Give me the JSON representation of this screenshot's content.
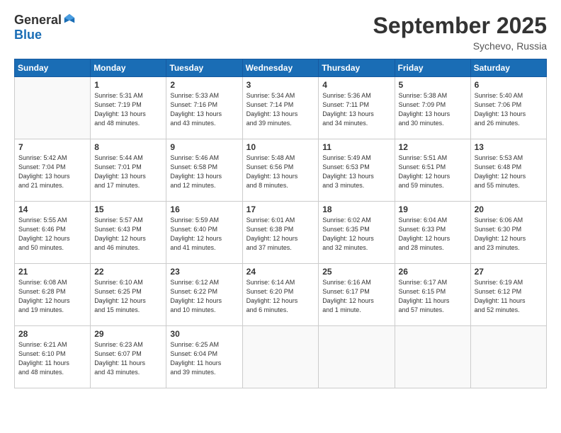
{
  "header": {
    "logo_general": "General",
    "logo_blue": "Blue",
    "month_title": "September 2025",
    "location": "Sychevo, Russia"
  },
  "weekdays": [
    "Sunday",
    "Monday",
    "Tuesday",
    "Wednesday",
    "Thursday",
    "Friday",
    "Saturday"
  ],
  "weeks": [
    [
      {
        "day": "",
        "info": ""
      },
      {
        "day": "1",
        "info": "Sunrise: 5:31 AM\nSunset: 7:19 PM\nDaylight: 13 hours\nand 48 minutes."
      },
      {
        "day": "2",
        "info": "Sunrise: 5:33 AM\nSunset: 7:16 PM\nDaylight: 13 hours\nand 43 minutes."
      },
      {
        "day": "3",
        "info": "Sunrise: 5:34 AM\nSunset: 7:14 PM\nDaylight: 13 hours\nand 39 minutes."
      },
      {
        "day": "4",
        "info": "Sunrise: 5:36 AM\nSunset: 7:11 PM\nDaylight: 13 hours\nand 34 minutes."
      },
      {
        "day": "5",
        "info": "Sunrise: 5:38 AM\nSunset: 7:09 PM\nDaylight: 13 hours\nand 30 minutes."
      },
      {
        "day": "6",
        "info": "Sunrise: 5:40 AM\nSunset: 7:06 PM\nDaylight: 13 hours\nand 26 minutes."
      }
    ],
    [
      {
        "day": "7",
        "info": "Sunrise: 5:42 AM\nSunset: 7:04 PM\nDaylight: 13 hours\nand 21 minutes."
      },
      {
        "day": "8",
        "info": "Sunrise: 5:44 AM\nSunset: 7:01 PM\nDaylight: 13 hours\nand 17 minutes."
      },
      {
        "day": "9",
        "info": "Sunrise: 5:46 AM\nSunset: 6:58 PM\nDaylight: 13 hours\nand 12 minutes."
      },
      {
        "day": "10",
        "info": "Sunrise: 5:48 AM\nSunset: 6:56 PM\nDaylight: 13 hours\nand 8 minutes."
      },
      {
        "day": "11",
        "info": "Sunrise: 5:49 AM\nSunset: 6:53 PM\nDaylight: 13 hours\nand 3 minutes."
      },
      {
        "day": "12",
        "info": "Sunrise: 5:51 AM\nSunset: 6:51 PM\nDaylight: 12 hours\nand 59 minutes."
      },
      {
        "day": "13",
        "info": "Sunrise: 5:53 AM\nSunset: 6:48 PM\nDaylight: 12 hours\nand 55 minutes."
      }
    ],
    [
      {
        "day": "14",
        "info": "Sunrise: 5:55 AM\nSunset: 6:46 PM\nDaylight: 12 hours\nand 50 minutes."
      },
      {
        "day": "15",
        "info": "Sunrise: 5:57 AM\nSunset: 6:43 PM\nDaylight: 12 hours\nand 46 minutes."
      },
      {
        "day": "16",
        "info": "Sunrise: 5:59 AM\nSunset: 6:40 PM\nDaylight: 12 hours\nand 41 minutes."
      },
      {
        "day": "17",
        "info": "Sunrise: 6:01 AM\nSunset: 6:38 PM\nDaylight: 12 hours\nand 37 minutes."
      },
      {
        "day": "18",
        "info": "Sunrise: 6:02 AM\nSunset: 6:35 PM\nDaylight: 12 hours\nand 32 minutes."
      },
      {
        "day": "19",
        "info": "Sunrise: 6:04 AM\nSunset: 6:33 PM\nDaylight: 12 hours\nand 28 minutes."
      },
      {
        "day": "20",
        "info": "Sunrise: 6:06 AM\nSunset: 6:30 PM\nDaylight: 12 hours\nand 23 minutes."
      }
    ],
    [
      {
        "day": "21",
        "info": "Sunrise: 6:08 AM\nSunset: 6:28 PM\nDaylight: 12 hours\nand 19 minutes."
      },
      {
        "day": "22",
        "info": "Sunrise: 6:10 AM\nSunset: 6:25 PM\nDaylight: 12 hours\nand 15 minutes."
      },
      {
        "day": "23",
        "info": "Sunrise: 6:12 AM\nSunset: 6:22 PM\nDaylight: 12 hours\nand 10 minutes."
      },
      {
        "day": "24",
        "info": "Sunrise: 6:14 AM\nSunset: 6:20 PM\nDaylight: 12 hours\nand 6 minutes."
      },
      {
        "day": "25",
        "info": "Sunrise: 6:16 AM\nSunset: 6:17 PM\nDaylight: 12 hours\nand 1 minute."
      },
      {
        "day": "26",
        "info": "Sunrise: 6:17 AM\nSunset: 6:15 PM\nDaylight: 11 hours\nand 57 minutes."
      },
      {
        "day": "27",
        "info": "Sunrise: 6:19 AM\nSunset: 6:12 PM\nDaylight: 11 hours\nand 52 minutes."
      }
    ],
    [
      {
        "day": "28",
        "info": "Sunrise: 6:21 AM\nSunset: 6:10 PM\nDaylight: 11 hours\nand 48 minutes."
      },
      {
        "day": "29",
        "info": "Sunrise: 6:23 AM\nSunset: 6:07 PM\nDaylight: 11 hours\nand 43 minutes."
      },
      {
        "day": "30",
        "info": "Sunrise: 6:25 AM\nSunset: 6:04 PM\nDaylight: 11 hours\nand 39 minutes."
      },
      {
        "day": "",
        "info": ""
      },
      {
        "day": "",
        "info": ""
      },
      {
        "day": "",
        "info": ""
      },
      {
        "day": "",
        "info": ""
      }
    ]
  ]
}
